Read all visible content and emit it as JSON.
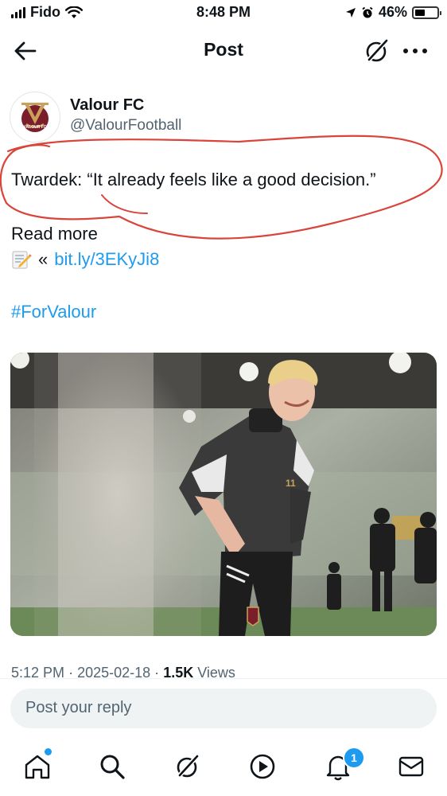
{
  "status_bar": {
    "carrier": "Fido",
    "time": "8:48 PM",
    "battery": "46%",
    "battery_level": 0.46
  },
  "nav": {
    "title": "Post",
    "icons": [
      "back-arrow-icon",
      "grok-icon",
      "more-icon"
    ]
  },
  "author": {
    "name": "Valour FC",
    "handle": "@ValourFootball",
    "logo_text": "VALOUR FC",
    "logo_colors": {
      "maroon": "#7a1e2c",
      "gold": "#c9a15a"
    }
  },
  "tweet": {
    "quote": "Twardek: “It already feels like a good decision.”",
    "read_more": "Read more",
    "link_prefix": "«",
    "link": "bit.ly/3EKyJi8",
    "hashtag": "#ForValour"
  },
  "meta": {
    "time": "5:12 PM",
    "sep1": "·",
    "date": "2025-02-18",
    "sep2": "·",
    "views": "1.5K",
    "views_label": "Views"
  },
  "reply": {
    "placeholder": "Post your reply"
  },
  "tabs": {
    "items": [
      "home-icon",
      "search-icon",
      "grok-icon",
      "video-icon",
      "notifications-icon",
      "messages-icon"
    ],
    "notification_count": "1"
  },
  "colors": {
    "accent": "#1d9bf0",
    "annotation": "#d9443b",
    "secondary_text": "#536471"
  }
}
